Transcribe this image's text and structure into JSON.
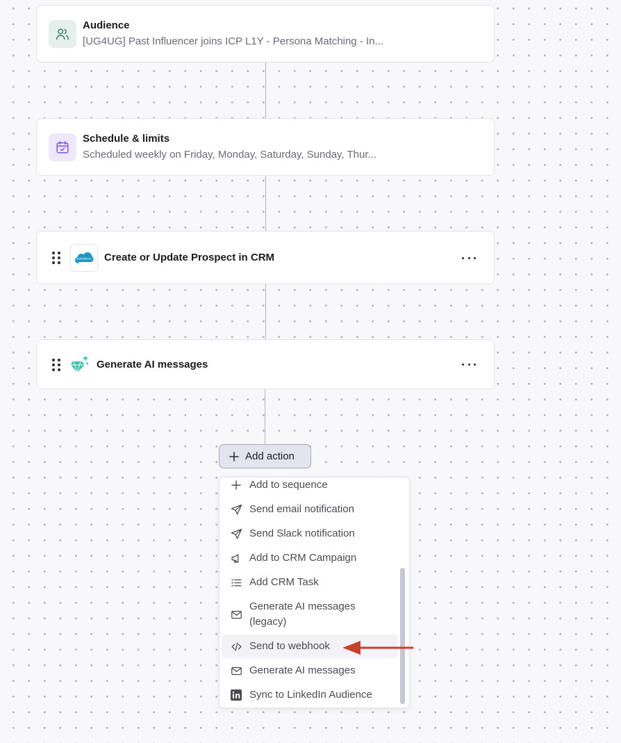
{
  "audience": {
    "title": "Audience",
    "subtitle": "[UG4UG] Past Influencer joins ICP L1Y - Persona Matching - In..."
  },
  "schedule": {
    "title": "Schedule & limits",
    "subtitle": "Scheduled weekly on Friday, Monday, Saturday, Sunday, Thur..."
  },
  "steps": [
    {
      "title": "Create or Update Prospect in CRM",
      "icon": "salesforce-logo",
      "logo_text": "salesforce"
    },
    {
      "title": "Generate AI messages",
      "icon": "ai-sparkle-icon"
    }
  ],
  "add_action": {
    "label": "Add action"
  },
  "action_menu": {
    "items": [
      {
        "label": "Add to sequence",
        "icon": "plus-icon"
      },
      {
        "label": "Send email notification",
        "icon": "send-icon"
      },
      {
        "label": "Send Slack notification",
        "icon": "send-icon"
      },
      {
        "label": "Add to CRM Campaign",
        "icon": "megaphone-icon"
      },
      {
        "label": "Add CRM Task",
        "icon": "list-icon"
      },
      {
        "label": "Generate AI messages (legacy)",
        "icon": "mail-icon"
      },
      {
        "label": "Send to webhook",
        "icon": "code-icon",
        "highlighted": true
      },
      {
        "label": "Generate AI messages",
        "icon": "mail-icon"
      },
      {
        "label": "Sync to LinkedIn Audience",
        "icon": "linkedin-icon"
      }
    ]
  },
  "colors": {
    "audience_icon_bg": "#e5efeb",
    "schedule_icon_bg": "#ede8fb",
    "salesforce_blue": "#1798c1",
    "ai_teal": "#3fbfae",
    "arrow_red": "#c8412d"
  }
}
